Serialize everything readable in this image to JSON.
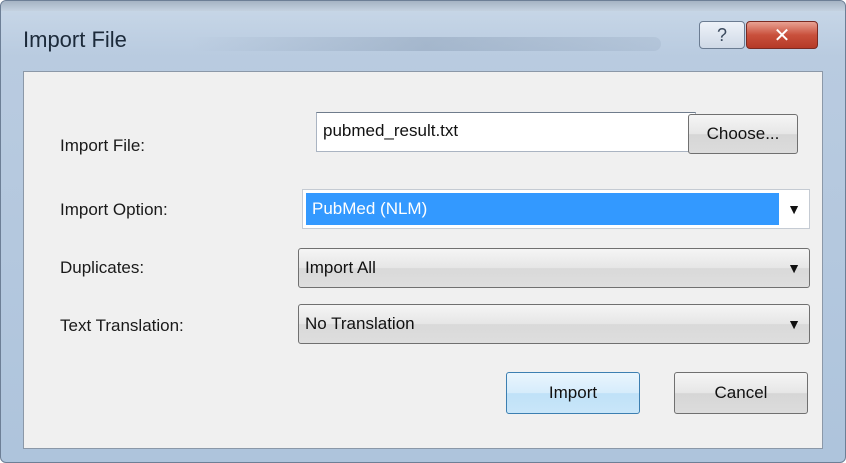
{
  "window": {
    "title": "Import File",
    "help_glyph": "?",
    "close_glyph": "✕"
  },
  "form": {
    "import_file_label": "Import File:",
    "import_file_value": "pubmed_result.txt",
    "choose_label": "Choose...",
    "import_option_label": "Import Option:",
    "import_option_value": "PubMed (NLM)",
    "duplicates_label": "Duplicates:",
    "duplicates_value": "Import All",
    "text_translation_label": "Text Translation:",
    "text_translation_value": "No Translation",
    "dropdown_glyph": "▼"
  },
  "actions": {
    "import_label": "Import",
    "cancel_label": "Cancel"
  },
  "icons": {
    "help": "help-icon",
    "close": "close-icon",
    "dropdown": "chevron-down-icon"
  },
  "colors": {
    "selection": "#3399ff",
    "close_button": "#c9503c",
    "default_button_border": "#3c7fb1"
  }
}
